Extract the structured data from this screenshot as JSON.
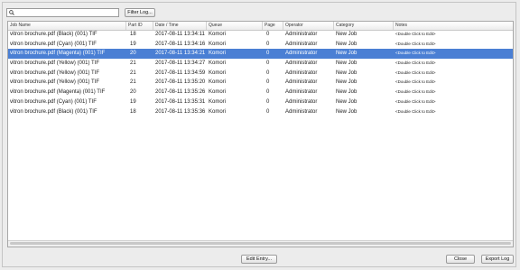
{
  "toolbar": {
    "search": {
      "value": "",
      "placeholder": ""
    },
    "filter_label": "Filter Log..."
  },
  "table": {
    "columns": [
      "Job Name",
      "Part ID",
      "Date / Time",
      "Queue",
      "Page",
      "Operator",
      "Category",
      "Notes"
    ],
    "rows": [
      [
        "vitron brochure.pdf (Black) (001) TIF",
        "18",
        "2017-08-11 13:34:11",
        "Komori",
        "0",
        "Administrator",
        "New Job",
        "<Double Click to Edit>"
      ],
      [
        "vitron brochure.pdf (Cyan) (001) TIF",
        "19",
        "2017-08-11 13:34:16",
        "Komori",
        "0",
        "Administrator",
        "New Job",
        "<Double Click to Edit>"
      ],
      [
        "vitron brochure.pdf (Magenta) (001) TIF",
        "20",
        "2017-08-11 13:34:21",
        "Komori",
        "0",
        "Administrator",
        "New Job",
        "<Double Click to Edit>"
      ],
      [
        "vitron brochure.pdf (Yellow) (001) TIF",
        "21",
        "2017-08-11 13:34:27",
        "Komori",
        "0",
        "Administrator",
        "New Job",
        "<Double Click to Edit>"
      ],
      [
        "vitron brochure.pdf (Yellow) (001) TIF",
        "21",
        "2017-08-11 13:34:59",
        "Komori",
        "0",
        "Administrator",
        "New Job",
        "<Double Click to Edit>"
      ],
      [
        "vitron brochure.pdf (Yellow) (001) TIF",
        "21",
        "2017-08-11 13:35:20",
        "Komori",
        "0",
        "Administrator",
        "New Job",
        "<Double Click to Edit>"
      ],
      [
        "vitron brochure.pdf (Magenta) (001) TIF",
        "20",
        "2017-08-11 13:35:26",
        "Komori",
        "0",
        "Administrator",
        "New Job",
        "<Double Click to Edit>"
      ],
      [
        "vitron brochure.pdf (Cyan) (001) TIF",
        "19",
        "2017-08-11 13:35:31",
        "Komori",
        "0",
        "Administrator",
        "New Job",
        "<Double Click to Edit>"
      ],
      [
        "vitron brochure.pdf (Black) (001) TIF",
        "18",
        "2017-08-11 13:35:36",
        "Komori",
        "0",
        "Administrator",
        "New Job",
        "<Double Click to Edit>"
      ]
    ],
    "selected_row": 2
  },
  "footer": {
    "edit_label": "Edit Entry...",
    "close_label": "Close",
    "export_label": "Export Log"
  },
  "colors": {
    "selection": "#4a7fd4"
  }
}
